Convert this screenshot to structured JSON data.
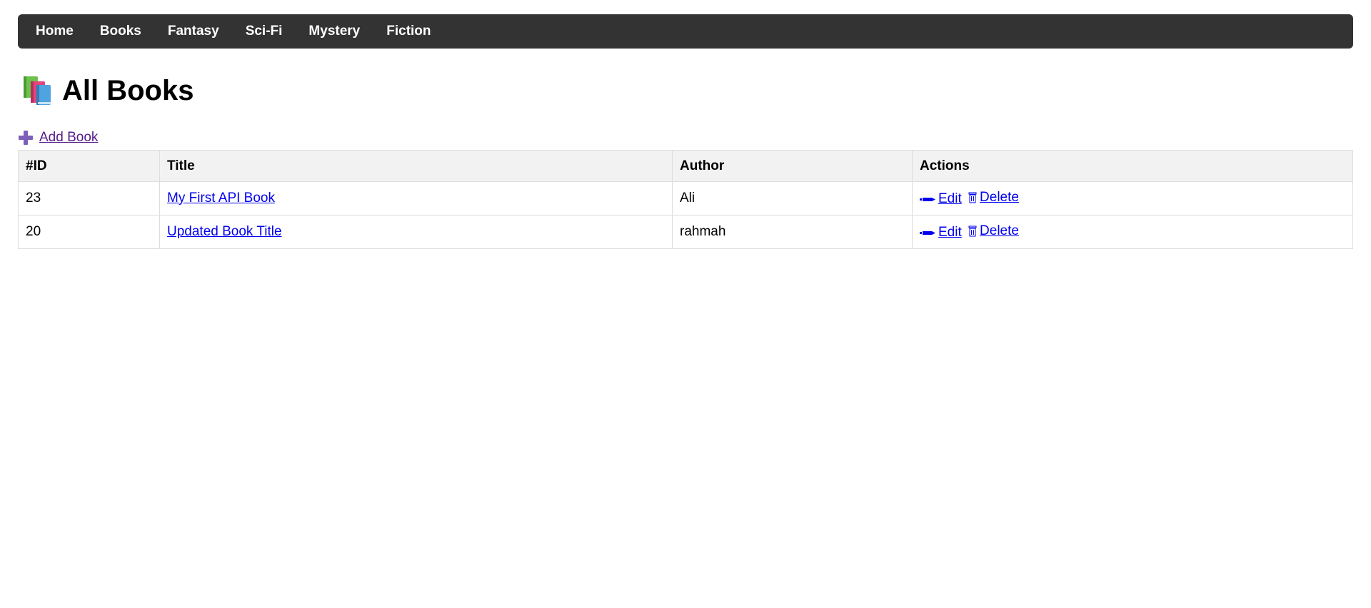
{
  "nav": {
    "items": [
      "Home",
      "Books",
      "Fantasy",
      "Sci-Fi",
      "Mystery",
      "Fiction"
    ]
  },
  "page": {
    "title": "All Books",
    "add_link_label": "Add Book"
  },
  "table": {
    "headers": [
      "#ID",
      "Title",
      "Author",
      "Actions"
    ],
    "rows": [
      {
        "id": "23",
        "title": "My First API Book",
        "author": "Ali",
        "edit_label": "Edit",
        "delete_label": "Delete"
      },
      {
        "id": "20",
        "title": "Updated Book Title",
        "author": "rahmah",
        "edit_label": "Edit",
        "delete_label": "Delete"
      }
    ]
  },
  "colors": {
    "navbar_bg": "#333333",
    "link": "#0000ee",
    "visited_link": "#551a8b",
    "header_bg": "#f2f2f2"
  }
}
